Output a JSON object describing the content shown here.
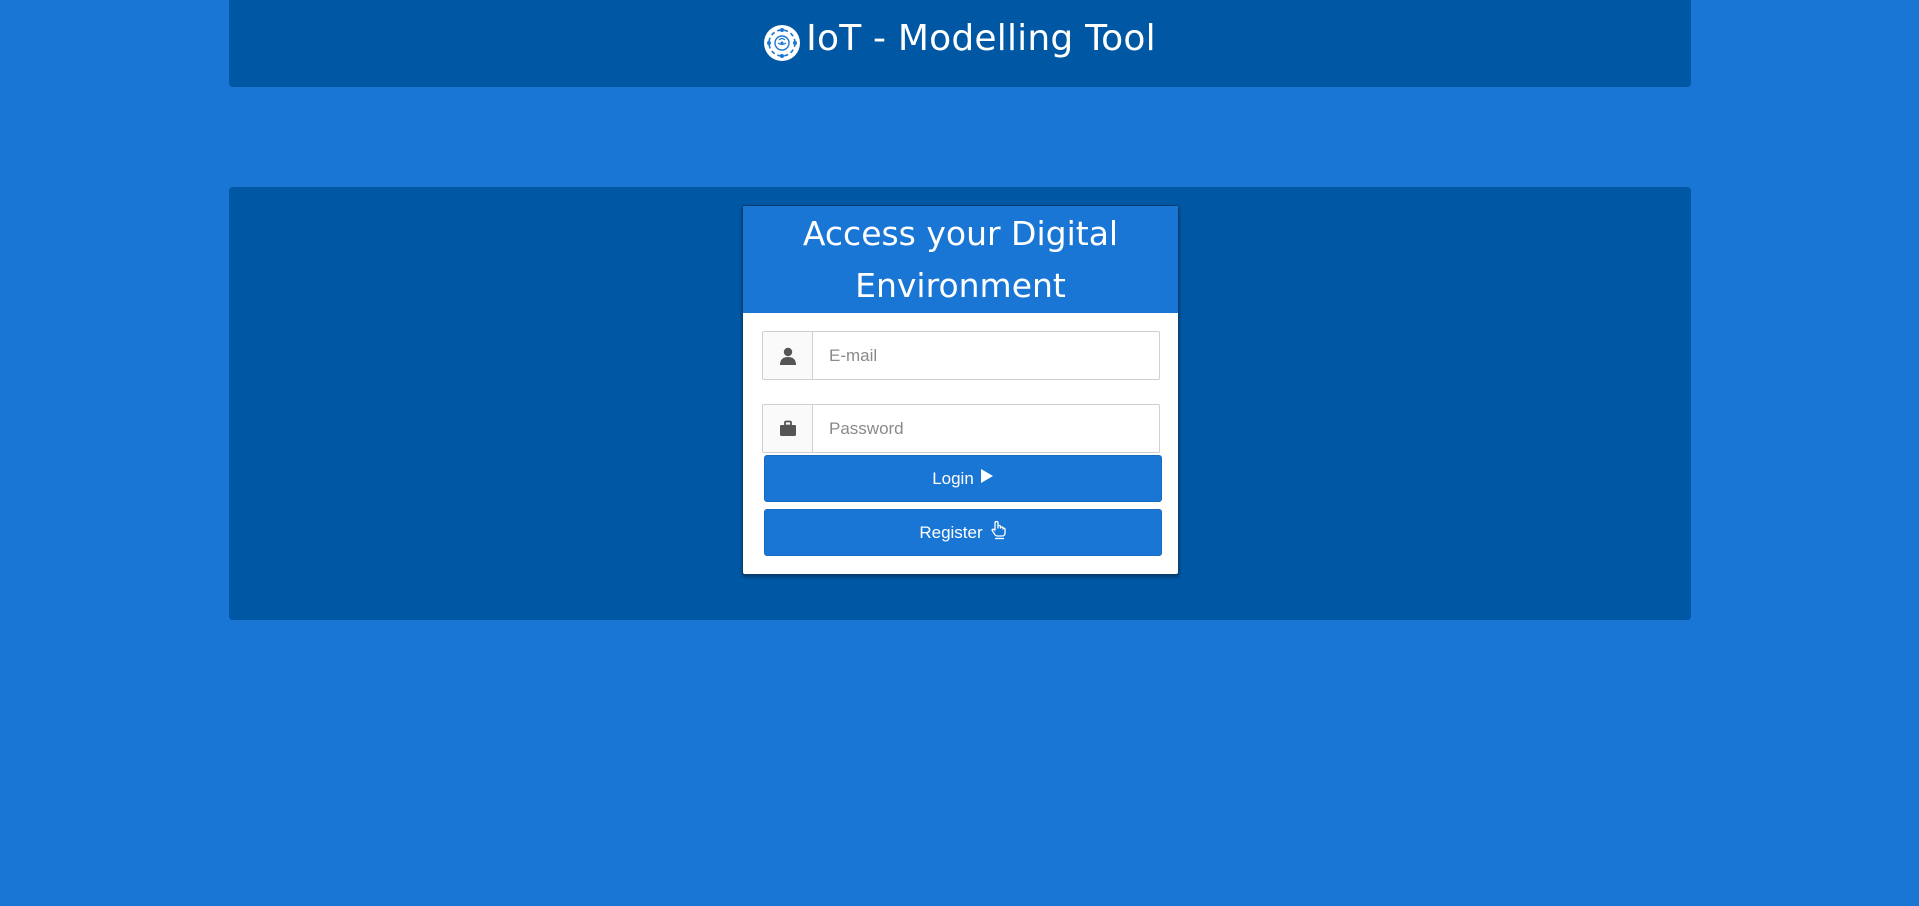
{
  "header": {
    "title": "IoT - Modelling Tool",
    "logo_icon": "iot-network-icon"
  },
  "login_card": {
    "title": "Access your Digital Environment",
    "email": {
      "placeholder": "E-mail",
      "value": "",
      "icon": "user-icon"
    },
    "password": {
      "placeholder": "Password",
      "value": "",
      "icon": "briefcase-icon"
    },
    "login_button": {
      "label": "Login",
      "icon": "play-icon"
    },
    "register_button": {
      "label": "Register",
      "icon": "pointing-hand-icon"
    }
  },
  "colors": {
    "background": "#1a76d4",
    "panel": "#0057a3",
    "button": "#1a76d4",
    "card": "#ffffff"
  }
}
